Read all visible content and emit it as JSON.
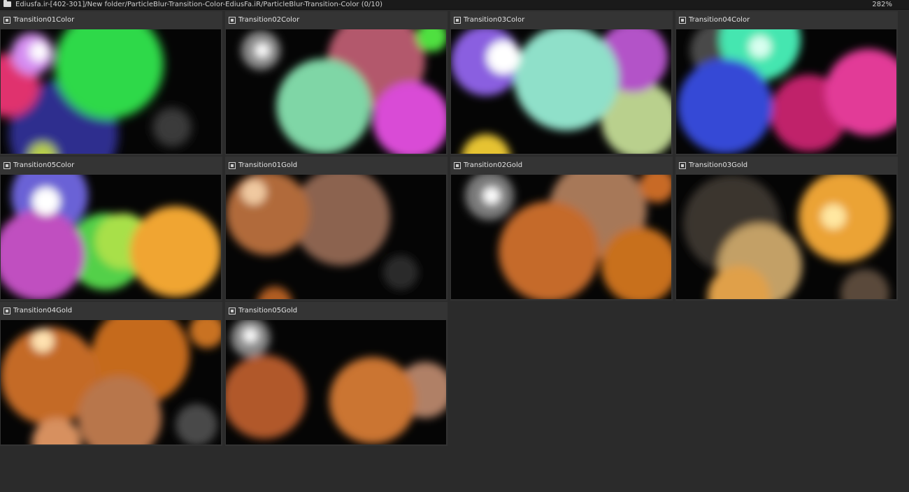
{
  "window": {
    "path": "Ediusfa.ir-[402-301]/New folder/ParticleBlur-Transition-Color-EdiusFa.iR/ParticleBlur-Transition-Color (0/10)",
    "zoom": "282%"
  },
  "items": [
    {
      "name": "Transition01Color"
    },
    {
      "name": "Transition02Color"
    },
    {
      "name": "Transition03Color"
    },
    {
      "name": "Transition04Color"
    },
    {
      "name": "Transition05Color"
    },
    {
      "name": "Transition01Gold"
    },
    {
      "name": "Transition02Gold"
    },
    {
      "name": "Transition03Gold"
    },
    {
      "name": "Transition04Gold"
    },
    {
      "name": "Transition05Gold"
    }
  ]
}
